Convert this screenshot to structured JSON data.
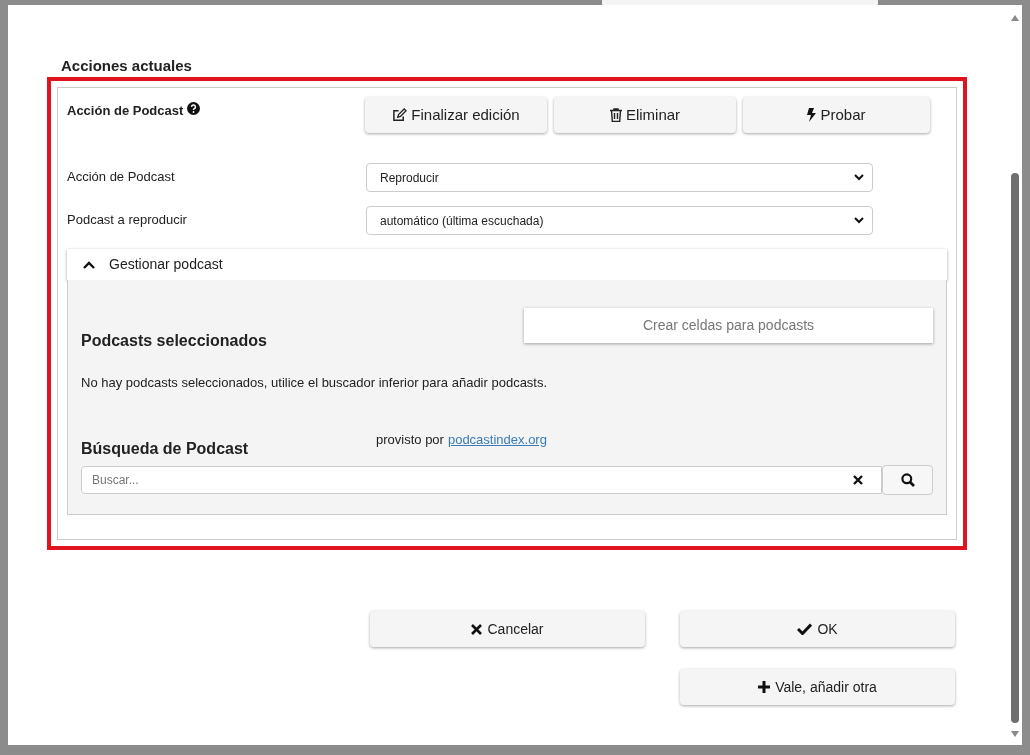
{
  "section_title": "Acciones actuales",
  "action": {
    "title": "Acción de Podcast",
    "buttons": [
      {
        "kind": "edit",
        "label": "Finalizar edición"
      },
      {
        "kind": "delete",
        "label": "Eliminar"
      },
      {
        "kind": "test",
        "label": "Probar"
      }
    ],
    "fields": [
      {
        "label": "Acción de Podcast",
        "value": "Reproducir"
      },
      {
        "label": "Podcast a reproducir",
        "value": "automático (última escuchada)"
      }
    ],
    "manage": {
      "label": "Gestionar podcast",
      "expanded": true,
      "create_button": "Crear celdas para podcasts",
      "selected_title": "Podcasts seleccionados",
      "empty_message": "No hay podcasts seleccionados, utilice el buscador inferior para añadir podcasts.",
      "search_title": "Búsqueda de Podcast",
      "provided_by": "provisto por",
      "provider_link": "podcastindex.org",
      "search_placeholder": "Buscar..."
    }
  },
  "footer_buttons": [
    {
      "kind": "cancel",
      "label": "Cancelar"
    },
    {
      "kind": "ok",
      "label": "OK"
    },
    {
      "kind": "add",
      "label": "Vale, añadir otra"
    }
  ]
}
